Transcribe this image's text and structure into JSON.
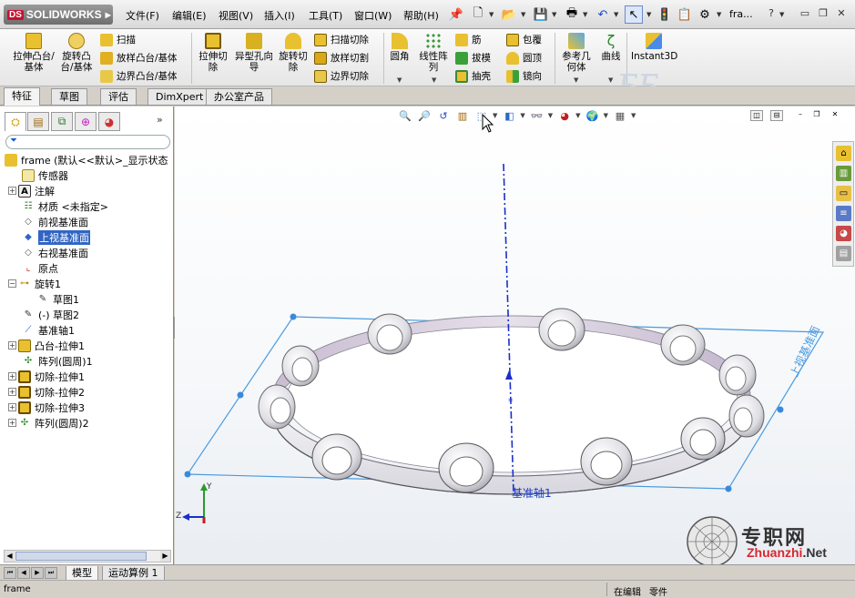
{
  "app": {
    "logo": "SOLIDWORKS",
    "logo_prefix": "DS",
    "doc_title": "fra...",
    "help": "?"
  },
  "menus": [
    "文件(F)",
    "编辑(E)",
    "视图(V)",
    "插入(I)",
    "工具(T)",
    "窗口(W)",
    "帮助(H)"
  ],
  "command_manager": {
    "buttons": {
      "extrude_boss": "拉伸凸台/基体",
      "revolve_boss": "旋转凸台/基体",
      "sweep": "扫描",
      "loft_boss": "放样凸台/基体",
      "boundary_boss": "边界凸台/基体",
      "extrude_cut": "拉伸切除",
      "hole_wizard": "异型孔向导",
      "revolve_cut": "旋转切除",
      "sweep_cut": "扫描切除",
      "loft_cut": "放样切割",
      "boundary_cut": "边界切除",
      "fillet": "圆角",
      "linear_pattern": "线性阵列",
      "rib": "筋",
      "draft": "拔模",
      "shell": "抽壳",
      "wrap": "包覆",
      "dome": "圆顶",
      "mirror": "镜向",
      "ref_geometry": "参考几何体",
      "curves": "曲线",
      "instant3d": "Instant3D"
    }
  },
  "tabs": [
    "特征",
    "草图",
    "评估",
    "DimXpert",
    "办公室产品"
  ],
  "tree": {
    "root": "frame  (默认<<默认>_显示状态",
    "items": [
      "传感器",
      "注解",
      "材质 <未指定>",
      "前视基准面",
      "上视基准面",
      "右视基准面",
      "原点",
      "旋转1",
      "草图1",
      "(-) 草图2",
      "基准轴1",
      "凸台-拉伸1",
      "阵列(圆周)1",
      "切除-拉伸1",
      "切除-拉伸2",
      "切除-拉伸3",
      "阵列(圆周)2"
    ]
  },
  "viewport": {
    "axis_label": "基准轴1",
    "plane_label": "上视基准面",
    "triad": {
      "y": "Y",
      "z": "Z"
    }
  },
  "bottom_tabs": [
    "模型",
    "运动算例 1"
  ],
  "status": {
    "left": "frame",
    "editing": "在编辑",
    "doc_type": "零件"
  },
  "watermark": {
    "title": "专职网",
    "url_a": "Zhuanzhi",
    "url_b": ".Net"
  },
  "colors": {
    "plane_blue": "#4a9be0",
    "axis_blue": "#1a2fc8",
    "ring_shade": "#cfc6d6",
    "selection": "#3165c4",
    "watermark_red": "#d8282e"
  }
}
